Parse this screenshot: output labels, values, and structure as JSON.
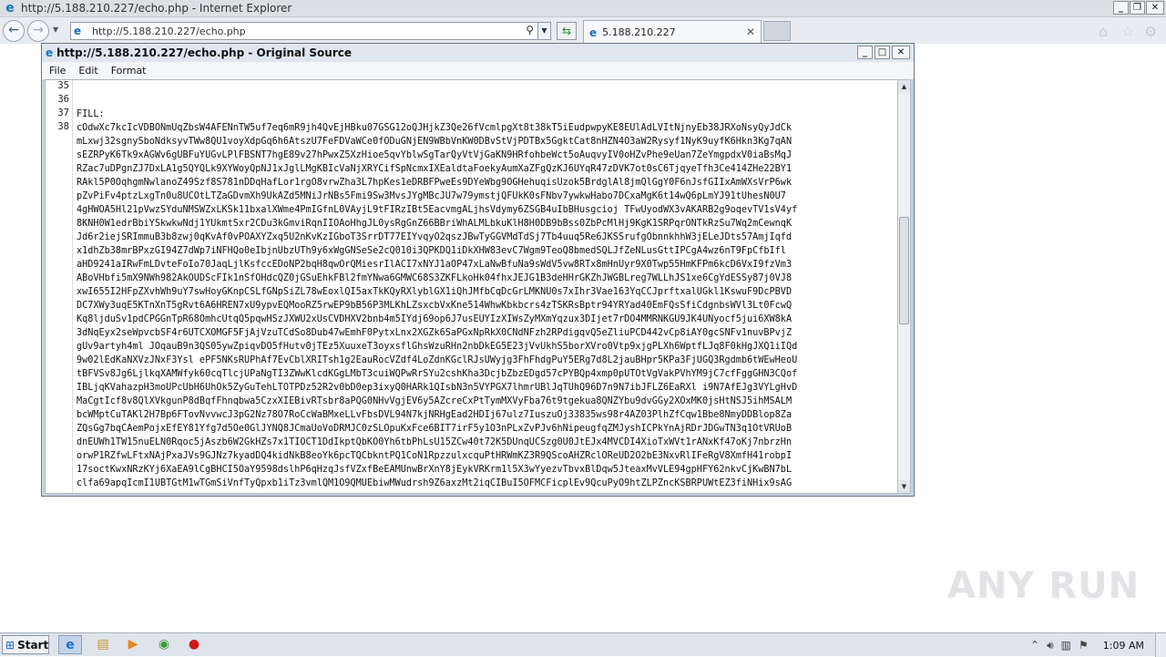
{
  "browser": {
    "window_title": "http://5.188.210.227/echo.php - Internet Explorer",
    "address": "http://5.188.210.227/echo.php",
    "tab_label": "5.188.210.227"
  },
  "source_window": {
    "title": "http://5.188.210.227/echo.php - Original Source",
    "menu": [
      "File",
      "Edit",
      "Format"
    ],
    "line_numbers": [
      "35",
      "36",
      "37",
      "38"
    ],
    "lines": [
      "",
      "",
      "FILL:",
      "cOdwXc7kcIcVDBONmUqZbsW4AFENnTW5uf7eq6mR9jh4QvEjHBku07GSG12oQJHjkZ3Qe26fVcmlpgXt8t38kT5iEudpwpyKE8EUlAdLVItNjnyEb38JRXoNsyQyJdCk",
      "mLxwj32sgnySboNdksyvTWw8QU1voyXdpGq6h6AtszU7FeFDVaWCe0fODuGNjEN9WBbVnKW0DBvStVjPDTBx5GgktCat8nHZN4O3aW2Rysyf1NyK9uyfK6Hkn3Kg7qAN",
      "sEZRPyK6Tk9xAGWv6gUBFuYUGvLPlFBSNT7hgE89v27hPwxZ5XzHioe5qvYblwSgTarQyVtVjGaKN9HRfohbeWct5oAuqvyIV0oHZvPhe9eUan7ZeYmgpdxV0iaBsMqJ",
      "RZac7uDPgnZJ7DxLA1g5QYQLk9XYWoyQpNJ1xJglLMgKBIcVaNjXRYCifSpNcmxIXEaldtaFoekyAumXaZFgQzKJ6UYqR47zDVK7ot0sC6TjqyeTfh3Ce414ZHe22BY1",
      "RAkl5P0OqhgmNwlanoZ49Szf8S781nDDqHafLor1rgO8vrwZha3L7hpKes1eDRBFPweEs9DYeWbg9OGHehuqisUzok5BrdglAl8jmQlGgY0F6nJsfGIIxAmWXsVrP6wk",
      "pZvPiFv4ptzLxgTn0u8UCOtLTZaGDvmXh9UkAZd5MNiJrNBs5Fmi9Sw3MvsJYgMBcJU7w79ymstjQFUkK0sFNbv7ywkwHabo7DCxaMgK6t14wQ6pLmYJ91tUhesN0U7",
      "4gHWOA5Hl21pVwzSYduNMSWZxLKSk11bxalXWme4PmIGfnL0VAyjL9tFIRzIBt5EacvmgALjhsVdymy6ZSGB4uIbBHusgcioj TFwUyodWX3vAKARB2g9oqevTV1sV4yf",
      "8KNH0W1edrBbiYSkwkwNdj1YUkmtSxr2CDu3kGmviRqnIIOAoHhgJL0ysRgGnZ66BBriWhALMLbkuKlH8H0DB9bBss0ZbPcMlHj9KgK1SRPqrONTkRzSu7Wq2mCewnqK",
      "Jd6r2iejSRImmuB3b8zwj0qKvAf0vPOAXYZxq5U2nKvKzIGboT3SrrDT77EIYvqyO2qszJBwTyGGVMdTdSj7Tb4uuq5Re6JKSSrufgObnnkhhW3jELeJDts57AmjIqfd",
      "x1dhZb38mrBPxzGI94Z7dWp7iNFHQo0eIbjnUbzUTh9y6xWgGNSeSe2cQ010i3QPKDQ1iDkXHW83evC7Wgm9TeoQ8bmedSQLJfZeNLusGttIPCgA4wz6nT9FpCfbIfl",
      "aHD9241aIRwFmLDvteFoIo70JaqLjlKsfccEDoNP2bqH8qwOrQMiesrIlACI7xNYJ1aOP47xLaNwBfuNa9sWdV5vw8RTx8mHnUyr9X0Twp55HmKFPm6kcD6VxI9fzVm3",
      "ABoVHbfi5mX9NWh982AkOUDScFIk1nSfOHdcQZ0jGSuEhkFBl2fmYNwa6GMWC68S3ZKFLkoHk04fhxJEJG1B3deHHrGKZhJWGBLreg7WLLhJS1xe6CgYdESSy87j0VJ8",
      "xwI655I2HFpZXvhWh9uY7swHoyGKnpCSLfGNpSiZL78wEoxlQI5axTkKQyRXlyblGX1iQhJMfbCqDcGrLMKNU0s7xIhr3Vae163YqCCJprftxalUGkl1KswuF9DcPBVD",
      "DC7XWy3uqE5KTnXnT5gRvt6A6HREN7xU9ypvEQMooRZ5rwEP9bB56P3MLKhLZsxcbVxKne514WhwKbkbcrs4zTSKRsBptr94YRYad40EmFQsSfiCdgnbsWVl3Lt0FcwQ",
      "Kq8ljduSv1pdCPGGnTpR68OmhcUtqQ5pqwHSzJXWU2xUsCVDHXV2bnb4m5IYdj69op6J7usEUYIzXIWsZyMXmYqzux3DIjet7rDO4MMRNKGU9JK4UNyocf5jui6XW8kA",
      "3dNqEyx2seWpvcbSF4r6UTCXOMGF5FjAjVzuTCdSo8Dub47wEmhF0PytxLnx2XGZk6SaPGxNpRkX0CNdNFzh2RPdigqvQ5eZliuPCD442vCp8iAY0gcSNFv1nuvBPvjZ",
      "gUv9artyh4ml JOqauB9n3QS05ywZpiqvDO5fHutv0jTEz5XuuxeT3oyxsflGhsWzuRHn2nbDkEG5E23jVvUkhS5borXVro0Vtp9xjgPLXh6WptfLJq8F0kHgJXQ1iIQd",
      "9w02lEdKaNXVzJNxF3Ysl ePF5NKsRUPhAf7EvCblXRITsh1g2EauRocVZdf4LoZdnKGclRJsUWyjg3FhFhdgPuY5ERg7d8L2jauBHpr5KPa3FjUGQ3Rgdmb6tWEwHeoU",
      "tBFVSv8Jg6LjlkqXAMWfyk60cqTlcjUPaNgTI3ZWwKlcdKGgLMbT3cuiWQPwRrSYu2cshKha3DcjbZbzEDgd57cPYBQp4xmp0pUTOtVgVakPVhYM9jC7cfFggGHN3CQof",
      "IBLjqKVahazpH3moUPcUbH6UhOk5ZyGuTehLTOTPDz52R2v0bD0ep3ixyQ0HARk1QIsbN3n5VYPGX7lhmrUBlJqTUhQ96D7n9N7ibJFLZ6EaRXl i9N7AfEJg3VYLgHvD",
      "MaCgtIcf8v8QlXVkgunP8dBqfFhnqbwa5CzxXIEBivRTsbr8aPQG0NHvVgjEV6y5AZcreCxPtTymMXVyFba76t9tgekua8QNZYbu9dvGGy2XOxMK0jsHtNSJ5ihMSALM",
      "bcWMptCuTAKl2H7Bp6FTovNvvwcJ3pG2Nz78O7RoCcWaBMxeLLvFbsDVL94N7kjNRHgEad2HDIj67ulz7IuszuOj33835ws98r4AZ03PlhZfCqw1Bbe8NmyDDBlop8Za",
      "ZQsGg7bqCAemPojxEfEY81Yfg7d5Oe0GlJYNQ8JCmaUoVoDRMJC0zSLOpuKxFce6BIT7irF5y1O3nPLxZvPJv6hNipeugfqZMJyshICPkYnAjRDrJDGwTN3q1OtVRUoB",
      "dnEUWh1TW15nuELN0Rqoc5jAszb6W2GkHZs7x1TIOCT1DdIkptQbKO0Yh6tbPhLsU15ZCw40t72K5DUnqUCSzg0U0JtEJx4MVCDI4XioTxWVt1rANxKf47oKj7nbrzHn",
      "orwP1RZfwLFtxNAjPxaJVs9GJNz7kyadDQ4kidNkB8eoYk6pcTQCbkntPQ1CoN1RpzzulxcquPtHRWmKZ3R9QScoAHZRclOReUD2O2bE3NxvRlIFeRgV8XmfH41robpI",
      "17soctKwxNRzKYj6XaEA9lCgBHCI5OaY9598dslhP6qHzqJsfVZxfBeEAMUnwBrXnY8jEykVRKrm1l5X3wYyezvTbvxBlDqw5JteaxMvVLE94gpHFY62nkvCjKwBN7bL",
      "clfa69apqIcmI1UBTGtM1wTGmSiVnfTyQpxb1iTz3vmlQM1O9QMUEbiwMWudrsh9Z6axzMt2iqCIBuI5OFMCFicplEv9QcuPyO9htZLPZncKSBRPUWtEZ3fiNHix9sAG"
    ]
  },
  "watermark": "ANY RUN",
  "taskbar": {
    "start_label": "Start",
    "clock": "1:09 AM"
  },
  "colors": {
    "ie_blue": "#1a6fc9",
    "titlebar_bg": "#dcdfe3",
    "source_frame": "#c9d3df"
  }
}
